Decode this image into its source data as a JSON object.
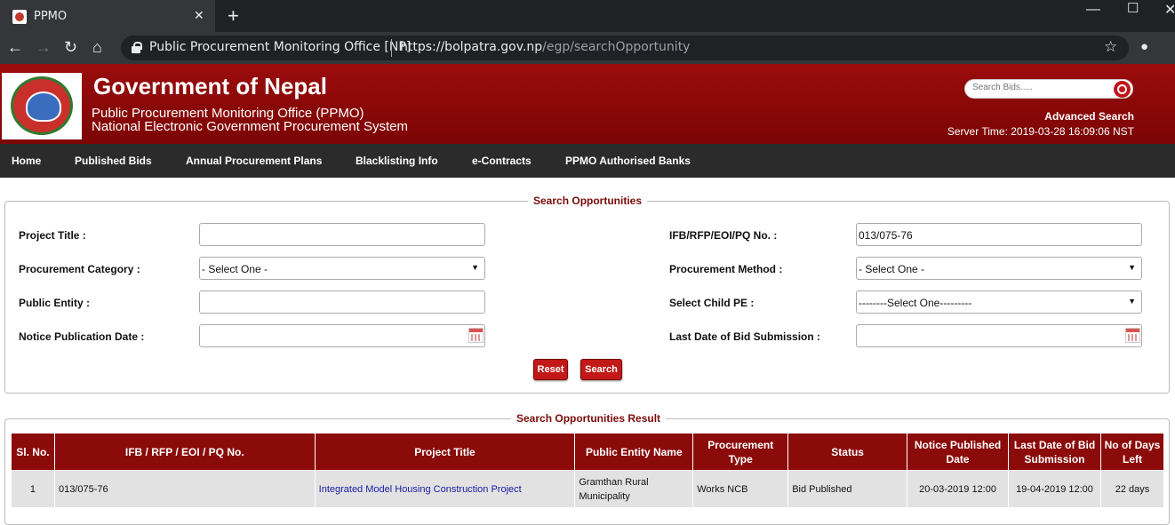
{
  "browser": {
    "tab_title": "PPMO",
    "site_name": "Public Procurement Monitoring Office [NP]",
    "url_host": "https://bolpatra.gov.np",
    "url_path": "/egp/searchOpportunity"
  },
  "header": {
    "title": "Government of Nepal",
    "subtitle1": "Public Procurement Monitoring Office (PPMO)",
    "subtitle2": "National Electronic Government Procurement System",
    "search_placeholder": "Search Bids.....",
    "advanced_search": "Advanced Search",
    "server_time": "Server Time: 2019-03-28 16:09:06 NST"
  },
  "nav": [
    "Home",
    "Published Bids",
    "Annual Procurement Plans",
    "Blacklisting Info",
    "e-Contracts",
    "PPMO Authorised Banks"
  ],
  "search_form": {
    "legend": "Search Opportunities",
    "project_title_label": "Project Title :",
    "project_title_value": "",
    "category_label": "Procurement Category :",
    "category_value": "- Select One -",
    "public_entity_label": "Public Entity :",
    "public_entity_value": "",
    "notice_date_label": "Notice Publication Date :",
    "notice_date_value": "",
    "ifb_label": "IFB/RFP/EOI/PQ No. :",
    "ifb_value": "013/075-76",
    "method_label": "Procurement Method :",
    "method_value": "- Select One -",
    "child_pe_label": "Select Child PE :",
    "child_pe_value": "--------Select One---------",
    "last_date_label": "Last Date of Bid Submission :",
    "last_date_value": "",
    "reset_label": "Reset",
    "search_label": "Search"
  },
  "results": {
    "legend": "Search Opportunities Result",
    "columns": [
      "Sl. No.",
      "IFB / RFP / EOI / PQ No.",
      "Project Title",
      "Public Entity Name",
      "Procurement Type",
      "Status",
      "Notice Published Date",
      "Last Date of Bid Submission",
      "No of Days Left"
    ],
    "rows": [
      {
        "sl": "1",
        "ifb": "013/075-76",
        "title": "Integrated Model Housing Construction Project",
        "entity": "Gramthan Rural Municipality",
        "type": "Works NCB",
        "status": "Bid Published",
        "published": "20-03-2019 12:00",
        "last_date": "19-04-2019 12:00",
        "days_left": "22 days"
      }
    ]
  },
  "colors": {
    "brand_red": "#8b0b0b",
    "nav_bg": "#2b2b2b",
    "link": "#1a1aa6"
  }
}
